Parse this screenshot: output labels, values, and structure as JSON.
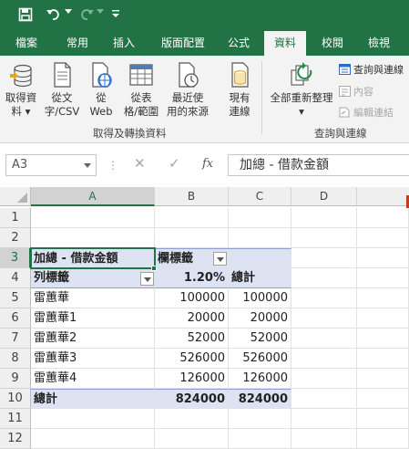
{
  "ribbon_tabs": [
    "檔案",
    "常用",
    "插入",
    "版面配置",
    "公式",
    "資料",
    "校閱",
    "檢視"
  ],
  "active_tab": "資料",
  "groups": {
    "get_transform": {
      "label": "取得及轉換資料",
      "buttons": [
        {
          "line1": "取得資",
          "line2": "料 ▾"
        },
        {
          "line1": "從文",
          "line2": "字/CSV"
        },
        {
          "line1": "從",
          "line2": "Web"
        },
        {
          "line1": "從表",
          "line2": "格/範圍"
        },
        {
          "line1": "最近使",
          "line2": "用的來源"
        },
        {
          "line1": "現有",
          "line2": "連線"
        }
      ]
    },
    "queries_connections": {
      "label": "查詢與連線",
      "refresh_all": {
        "line1": "全部重新整理",
        "line2": "▾"
      },
      "items": [
        "查詢與連線",
        "內容",
        "編輯連結"
      ]
    }
  },
  "formula_bar": {
    "name_box": "A3",
    "cancel_glyph": "✕",
    "enter_glyph": "✓",
    "fx_label": "fx",
    "dots": "⋮",
    "content": "加總 - 借款金額"
  },
  "columns": [
    "A",
    "B",
    "C",
    "D"
  ],
  "rows": [
    "1",
    "2",
    "3",
    "4",
    "5",
    "6",
    "7",
    "8",
    "9",
    "10",
    "11",
    "12"
  ],
  "pivot": {
    "value_field": "加總 - 借款金額",
    "col_labels_caption": "欄標籤",
    "row_labels_caption": "列標籤",
    "col_item": "1.20%",
    "grand_total_label": "總計",
    "data_rows": [
      {
        "label": "雷蕙華",
        "b": "100000",
        "c": "100000"
      },
      {
        "label": "雷蕙華1",
        "b": "20000",
        "c": "20000"
      },
      {
        "label": "雷蕙華2",
        "b": "52000",
        "c": "52000"
      },
      {
        "label": "雷蕙華3",
        "b": "526000",
        "c": "526000"
      },
      {
        "label": "雷蕙華4",
        "b": "126000",
        "c": "126000"
      }
    ],
    "total_row": {
      "label": "總計",
      "b": "824000",
      "c": "824000"
    }
  },
  "colors": {
    "excel_green": "#217346",
    "pivot_band": "#dde3f3"
  }
}
